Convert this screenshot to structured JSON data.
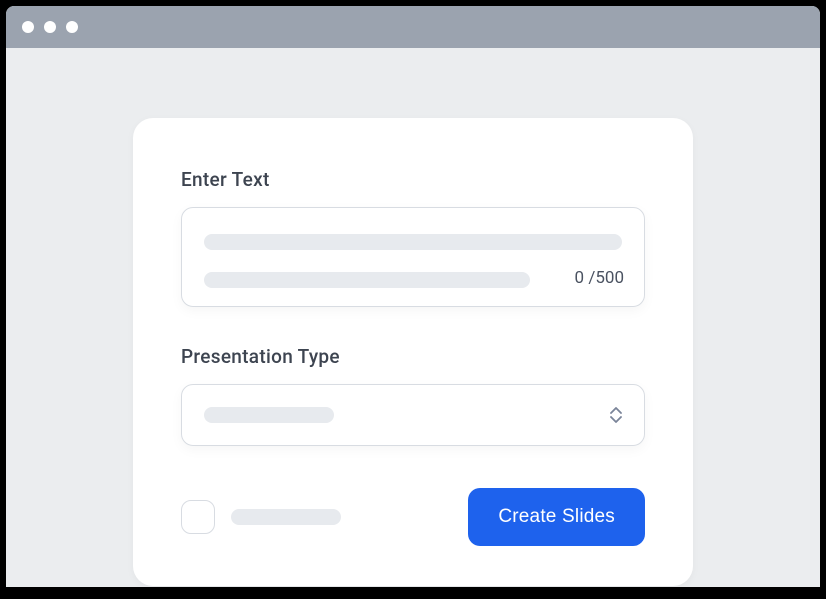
{
  "form": {
    "text_label": "Enter Text",
    "char_count": "0 /500",
    "type_label": "Presentation Type",
    "submit_label": "Create Slides"
  }
}
